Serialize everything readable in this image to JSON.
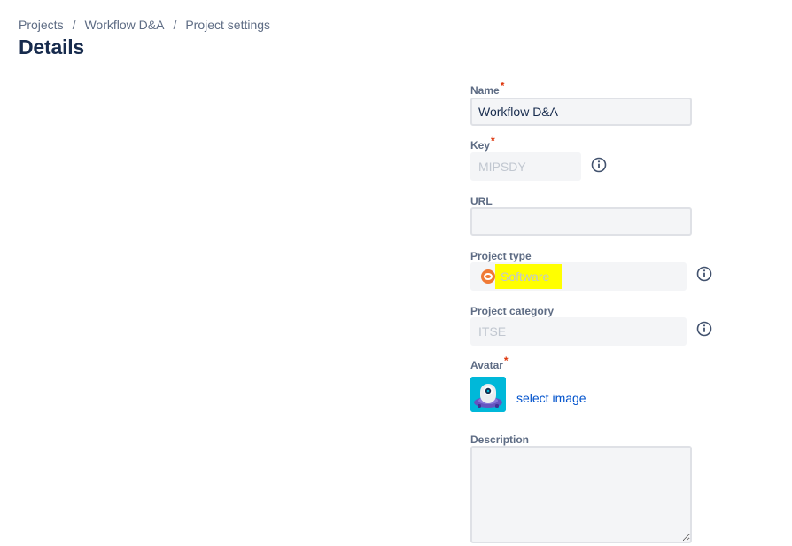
{
  "breadcrumb": {
    "items": [
      "Projects",
      "Workflow D&A",
      "Project settings"
    ],
    "separator": "/"
  },
  "page_title": "Details",
  "form": {
    "name": {
      "label": "Name",
      "required": "*",
      "value": "Workflow D&A"
    },
    "key": {
      "label": "Key",
      "required": "*",
      "value": "MIPSDY"
    },
    "url": {
      "label": "URL",
      "value": ""
    },
    "project_type": {
      "label": "Project type",
      "value": "Software",
      "icon": "software-icon"
    },
    "project_category": {
      "label": "Project category",
      "value": "ITSE"
    },
    "avatar": {
      "label": "Avatar",
      "required": "*",
      "select_label": "select image"
    },
    "description": {
      "label": "Description",
      "value": ""
    }
  },
  "colors": {
    "accent_link": "#0052cc",
    "required": "#de350b",
    "highlight": "#ffff00",
    "project_type_icon": "#f07a35",
    "avatar_bg": "#00b8d9"
  }
}
